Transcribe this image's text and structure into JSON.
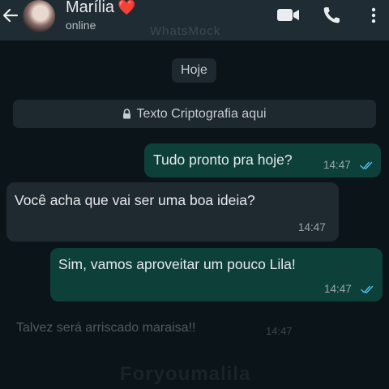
{
  "header": {
    "contact_name": "Marília",
    "heart_emoji": "❤️",
    "status": "online",
    "watermark": "WhatsMock",
    "icons": [
      "back-arrow-icon",
      "video-call-icon",
      "voice-call-icon",
      "more-options-icon"
    ]
  },
  "chat": {
    "date_label": "Hoje",
    "encryption_notice": "Texto Criptografia aqui",
    "messages": [
      {
        "direction": "outgoing",
        "text": "Tudo pronto pra hoje?",
        "time": "14:47",
        "read": true
      },
      {
        "direction": "incoming",
        "text": "Você acha que vai ser uma boa ideia?",
        "time": "14:47"
      },
      {
        "direction": "outgoing",
        "text": "Sim, vamos aproveitar um pouco Lila!",
        "time": "14:47",
        "read": true
      }
    ],
    "faded_message": {
      "text": "Talvez será arriscado maraisa!!",
      "time": "14:47"
    },
    "bottom_watermark": "Foryoumalila"
  },
  "colors": {
    "background": "#0b1418",
    "header": "#1f2c33",
    "outgoing_bubble": "#0e403a",
    "incoming_bubble": "#1f2a30",
    "read_ticks": "#53bdeb"
  }
}
